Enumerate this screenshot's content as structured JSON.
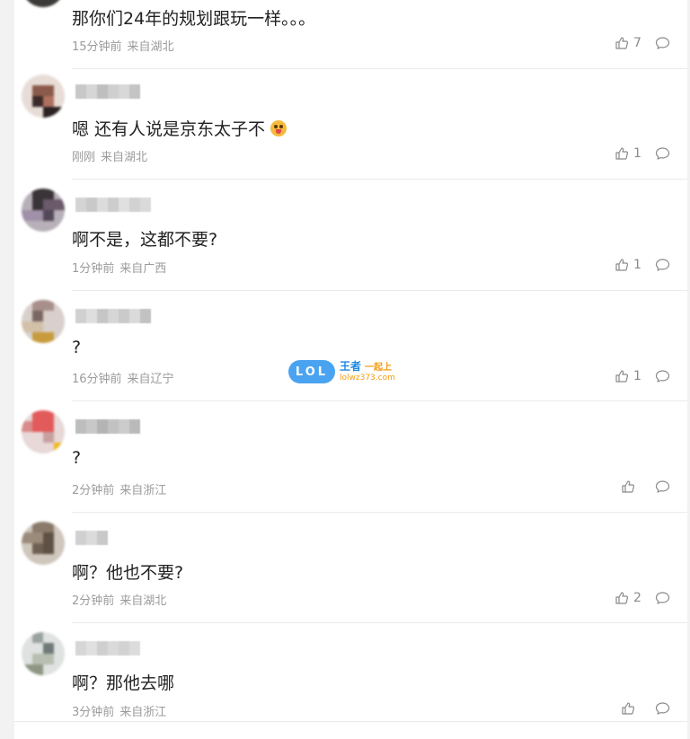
{
  "comments": [
    {
      "text": "那你们24年的规划跟玩一样。。。",
      "time": "15分钟前",
      "location": "来自湖北",
      "likes": "7"
    },
    {
      "text": "嗯 还有人说是京东太子不",
      "emoji": "grinning-face-with-tongue",
      "time": "刚刚",
      "location": "来自湖北",
      "likes": "1"
    },
    {
      "text": "啊不是，这都不要?",
      "time": "1分钟前",
      "location": "来自广西",
      "likes": "1"
    },
    {
      "text": "?",
      "time": "16分钟前",
      "location": "来自辽宁",
      "likes": "1"
    },
    {
      "text": "?",
      "time": "2分钟前",
      "location": "来自浙江",
      "likes": ""
    },
    {
      "text": "啊？他也不要?",
      "time": "2分钟前",
      "location": "来自湖北",
      "likes": "2"
    },
    {
      "text": "啊？那他去哪",
      "time": "3分钟前",
      "location": "来自浙江",
      "likes": ""
    }
  ],
  "watermark": {
    "logo": "LOL",
    "title": "王者",
    "subtitle": "一起上",
    "url": "lolwz373.com"
  },
  "colors": {
    "text": "#222222",
    "meta": "#9b9b9b",
    "icon": "#8a8a8a",
    "divider": "#ebebeb",
    "background": "#f2f2f2"
  },
  "icons": {
    "like": "thumbs-up-icon",
    "reply": "speech-bubble-icon"
  }
}
